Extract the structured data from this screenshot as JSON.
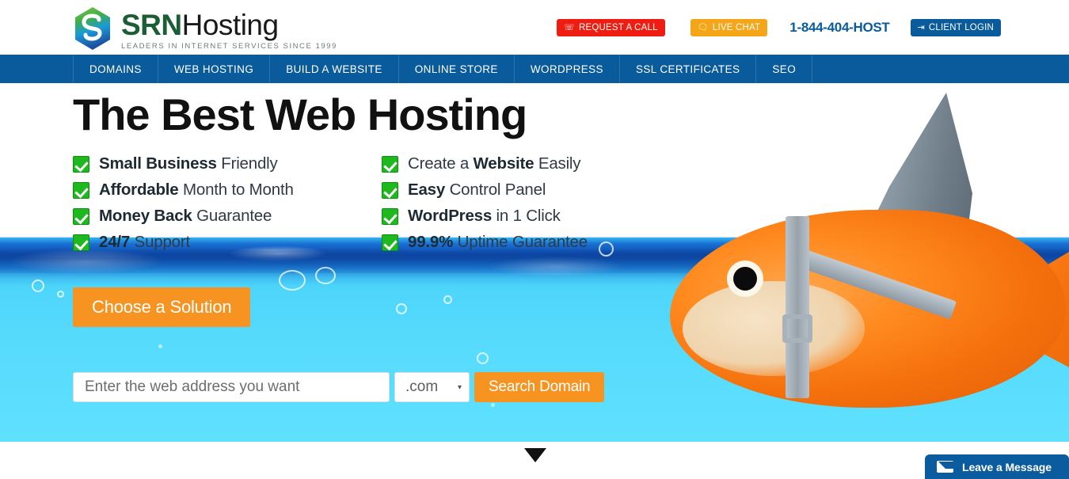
{
  "header": {
    "logo": {
      "icon": "hex-s-logo-icon",
      "name_bold": "SRN",
      "name_light": "Hosting",
      "tagline": "LEADERS IN INTERNET SERVICES SINCE 1999"
    },
    "actions": {
      "request_call": {
        "label": "REQUEST A CALL",
        "icon": "phone-icon",
        "color": "#ee1c11"
      },
      "live_chat": {
        "label": "LIVE CHAT",
        "icon": "chat-bubble-icon",
        "color": "#f5a518"
      },
      "phone": "1-844-404-HOST",
      "client_login": {
        "label": "CLIENT LOGIN",
        "icon": "login-arrow-icon",
        "color": "#0a5b9c"
      }
    }
  },
  "nav": {
    "background": "#0a5b9c",
    "items": [
      {
        "label": "DOMAINS"
      },
      {
        "label": "WEB HOSTING"
      },
      {
        "label": "BUILD A WEBSITE"
      },
      {
        "label": "ONLINE STORE"
      },
      {
        "label": "WORDPRESS"
      },
      {
        "label": "SSL CERTIFICATES"
      },
      {
        "label": "SEO"
      }
    ]
  },
  "hero": {
    "headline": "The Best Web Hosting",
    "features_left": [
      {
        "strong": "Small Business",
        "rest": " Friendly"
      },
      {
        "strong": "Affordable",
        "rest": " Month to Month"
      },
      {
        "strong": "Money Back",
        "rest": " Guarantee"
      },
      {
        "strong": "24/7",
        "rest": " Support"
      }
    ],
    "features_right": [
      {
        "strong": "Website",
        "pre": "Create a ",
        "rest": " Easily"
      },
      {
        "strong": "Easy",
        "rest": " Control Panel"
      },
      {
        "strong": "WordPress",
        "rest": " in 1 Click"
      },
      {
        "strong": "99.9%",
        "rest": " Uptime Guarantee"
      }
    ],
    "cta_label": "Choose a Solution",
    "cta_color": "#f79421",
    "search": {
      "placeholder": "Enter the web address you want",
      "value": "",
      "tld_selected": ".com",
      "tld_caret": "▾",
      "button_label": "Search Domain"
    },
    "scroll_hint_icon": "down-triangle-icon",
    "artwork": "goldfish-with-shark-fin-harness"
  },
  "chat_widget": {
    "label": "Leave a Message",
    "icon": "envelope-icon",
    "color": "#0b5c9e"
  }
}
